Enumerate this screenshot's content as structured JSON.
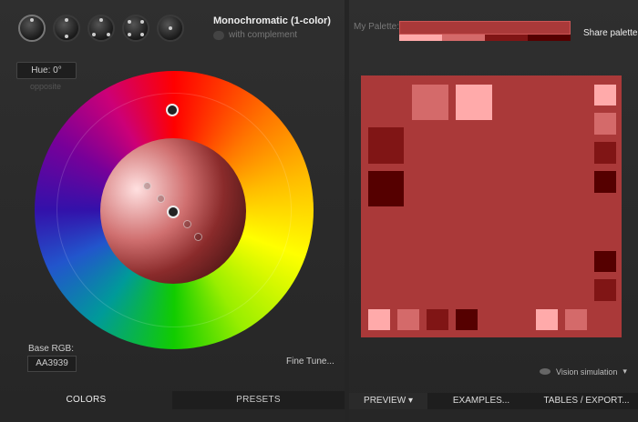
{
  "scheme": {
    "title": "Monochromatic (1-color)",
    "option": "with complement",
    "icons": [
      "mono-scheme-icon",
      "complement-scheme-icon",
      "triad-scheme-icon",
      "tetrad-scheme-icon",
      "freestyle-scheme-icon"
    ]
  },
  "wheel": {
    "hue_label": "Hue: 0°",
    "opposite_label": "opposite",
    "base_rgb_label": "Base RGB:",
    "base_rgb_value": "AA3939",
    "fine_tune": "Fine Tune..."
  },
  "left_tabs": [
    "COLORS",
    "PRESETS"
  ],
  "palette": {
    "label": "My Palette:",
    "main_color": "#aa3939",
    "strip_colors": [
      "#ffaaaa",
      "#d46a6a",
      "#801515",
      "#550000"
    ],
    "share": "Share palette"
  },
  "preview": {
    "background": "#aa3939",
    "vision": "Vision simulation"
  },
  "right_tabs": [
    "PREVIEW",
    "EXAMPLES...",
    "TABLES / EXPORT..."
  ]
}
